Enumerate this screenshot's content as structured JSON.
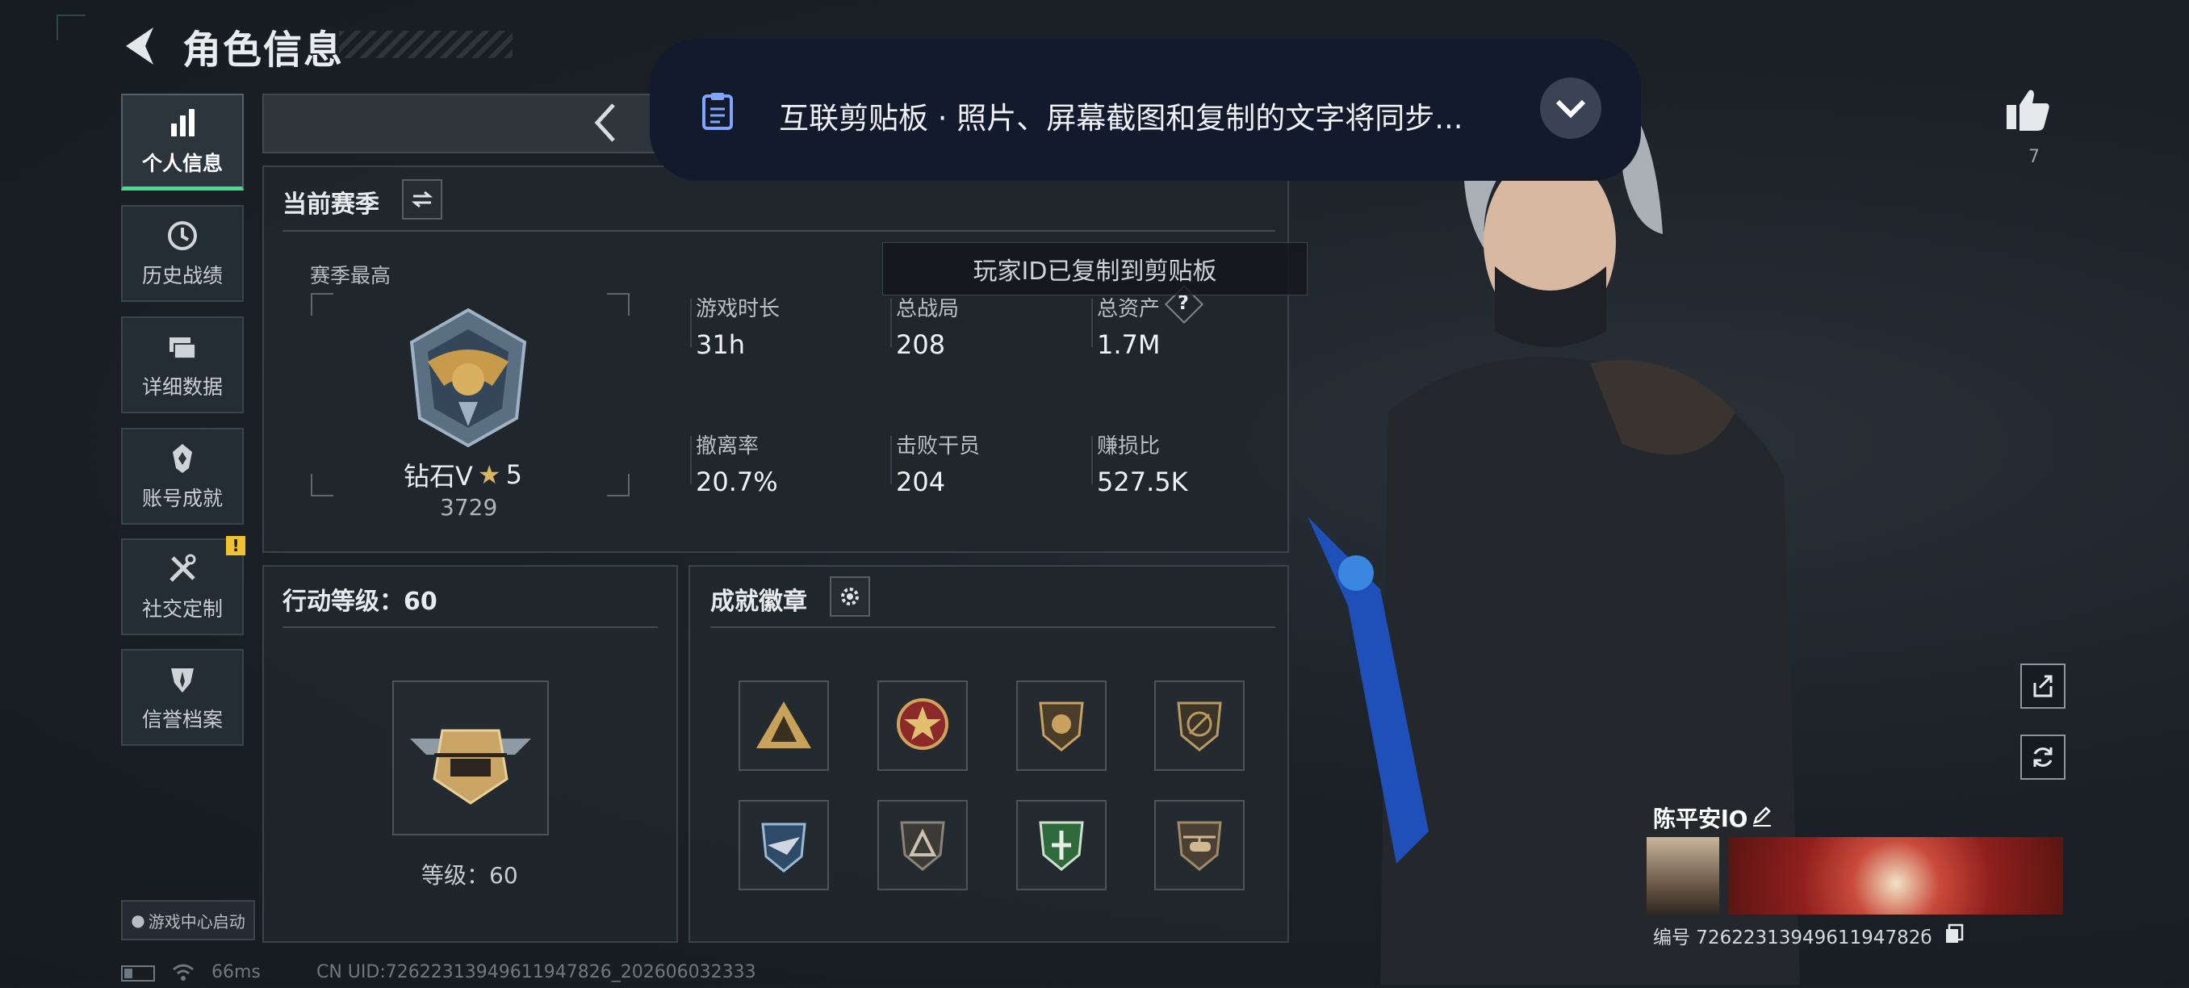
{
  "header": {
    "title": "角色信息"
  },
  "sidebar": {
    "items": [
      {
        "label": "个人信息",
        "icon": "bar-chart-icon",
        "active": true
      },
      {
        "label": "历史战绩",
        "icon": "history-clock-icon"
      },
      {
        "label": "详细数据",
        "icon": "folders-icon"
      },
      {
        "label": "账号成就",
        "icon": "achievement-crest-icon"
      },
      {
        "label": "社交定制",
        "icon": "tools-icon",
        "badge": "!"
      },
      {
        "label": "信誉档案",
        "icon": "reputation-shield-icon"
      }
    ],
    "game_center": "游戏中心启动"
  },
  "season": {
    "title": "当前赛季",
    "best_label": "赛季最高",
    "rank_name": "钻石V",
    "rank_stars": "5",
    "rank_score": "3729",
    "stats": [
      {
        "label": "游戏时长",
        "value": "31h"
      },
      {
        "label": "总战局",
        "value": "208"
      },
      {
        "label": "总资产",
        "value": "1.7M",
        "help": "?"
      },
      {
        "label": "撤离率",
        "value": "20.7%"
      },
      {
        "label": "击败干员",
        "value": "204"
      },
      {
        "label": "赚损比",
        "value": "527.5K"
      }
    ]
  },
  "action_level": {
    "title": "行动等级：60",
    "level_text": "等级：60"
  },
  "achievements": {
    "title": "成就徽章",
    "badges": [
      "badge-triangle-soldiers",
      "badge-star-emblem",
      "badge-shield-lion",
      "badge-shield-no-weapon",
      "badge-winged-gear",
      "badge-dark-triangle",
      "badge-green-shield",
      "badge-helicopter"
    ]
  },
  "clipboard": {
    "text": "互联剪贴板 · 照片、屏幕截图和复制的文字将同步..."
  },
  "toast": "玩家ID已复制到剪贴板",
  "likes": {
    "count": "7"
  },
  "player": {
    "name": "陈平安lO",
    "id_text": "编号 7262231394961194782б"
  },
  "status": {
    "ping": "66ms",
    "uid_text": "CN UID:72622313949611947826_202606032333"
  },
  "colors": {
    "accent_green": "#3ee08e",
    "warning": "#f2c230",
    "clipboard_bg": "#121a2b"
  }
}
